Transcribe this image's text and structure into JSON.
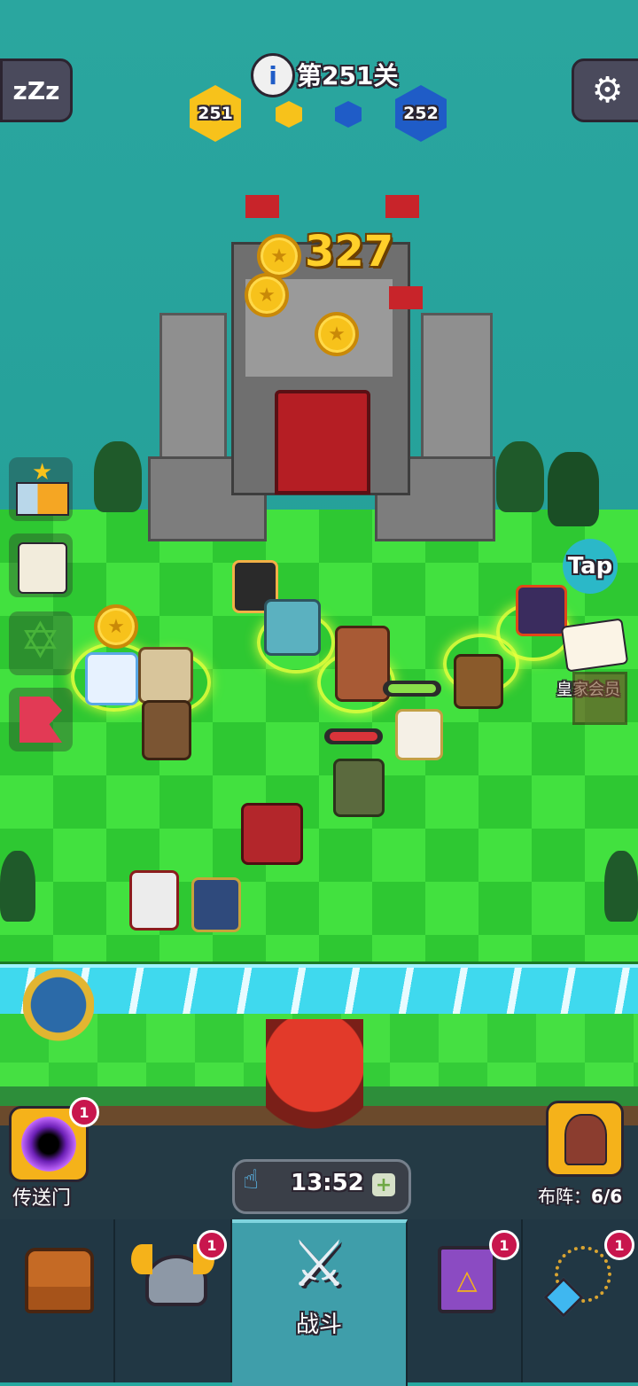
{
  "header": {
    "level_label": "第251关",
    "my_level_hex": "251",
    "enemy_level_hex": "252"
  },
  "castle": {
    "coin_count": "327"
  },
  "side_buttons": [
    {
      "icon": "trophy-icon"
    },
    {
      "icon": "scroll-map-icon"
    },
    {
      "icon": "hexagram-icon"
    },
    {
      "icon": "red-banner-icon"
    }
  ],
  "tap_bubble": "Tap",
  "royal_member_label": "皇家会员",
  "portal": {
    "label": "传送门",
    "badge": "1"
  },
  "timer": {
    "value": "13:52"
  },
  "formation": {
    "label": "布阵：",
    "value": "6/6"
  },
  "bottom_nav": [
    {
      "name": "chest",
      "icon": "treasure-chest-icon",
      "badge": ""
    },
    {
      "name": "heroes",
      "icon": "viking-helmet-icon",
      "badge": "1"
    },
    {
      "name": "battle",
      "icon": "crossed-swords-icon",
      "label": "战斗",
      "badge": ""
    },
    {
      "name": "spellbook",
      "icon": "spellbook-icon",
      "badge": "1"
    },
    {
      "name": "amulet",
      "icon": "amulet-icon",
      "badge": "1"
    }
  ],
  "colors": {
    "sea": "#27a8a0",
    "grass_light": "#3ee83e",
    "grass_dark": "#25c22a",
    "nav_bg": "#213744",
    "nav_active": "#3f9eaa",
    "badge": "#c8164d",
    "gold": "#f7c21b",
    "blue_hex": "#1f5cc7"
  }
}
